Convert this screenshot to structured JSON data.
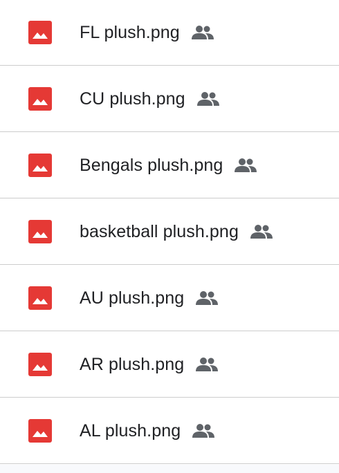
{
  "files": [
    {
      "name": "FL plush.png",
      "icon": "image-file-icon",
      "shared_icon": "shared-people-icon"
    },
    {
      "name": "CU plush.png",
      "icon": "image-file-icon",
      "shared_icon": "shared-people-icon"
    },
    {
      "name": "Bengals plush.png",
      "icon": "image-file-icon",
      "shared_icon": "shared-people-icon"
    },
    {
      "name": "basketball plush.png",
      "icon": "image-file-icon",
      "shared_icon": "shared-people-icon"
    },
    {
      "name": "AU plush.png",
      "icon": "image-file-icon",
      "shared_icon": "shared-people-icon"
    },
    {
      "name": "AR plush.png",
      "icon": "image-file-icon",
      "shared_icon": "shared-people-icon"
    },
    {
      "name": "AL plush.png",
      "icon": "image-file-icon",
      "shared_icon": "shared-people-icon"
    }
  ],
  "colors": {
    "image_icon": "#e53935",
    "text": "#202124",
    "shared_icon": "#5f6368",
    "divider": "#cccccc"
  }
}
